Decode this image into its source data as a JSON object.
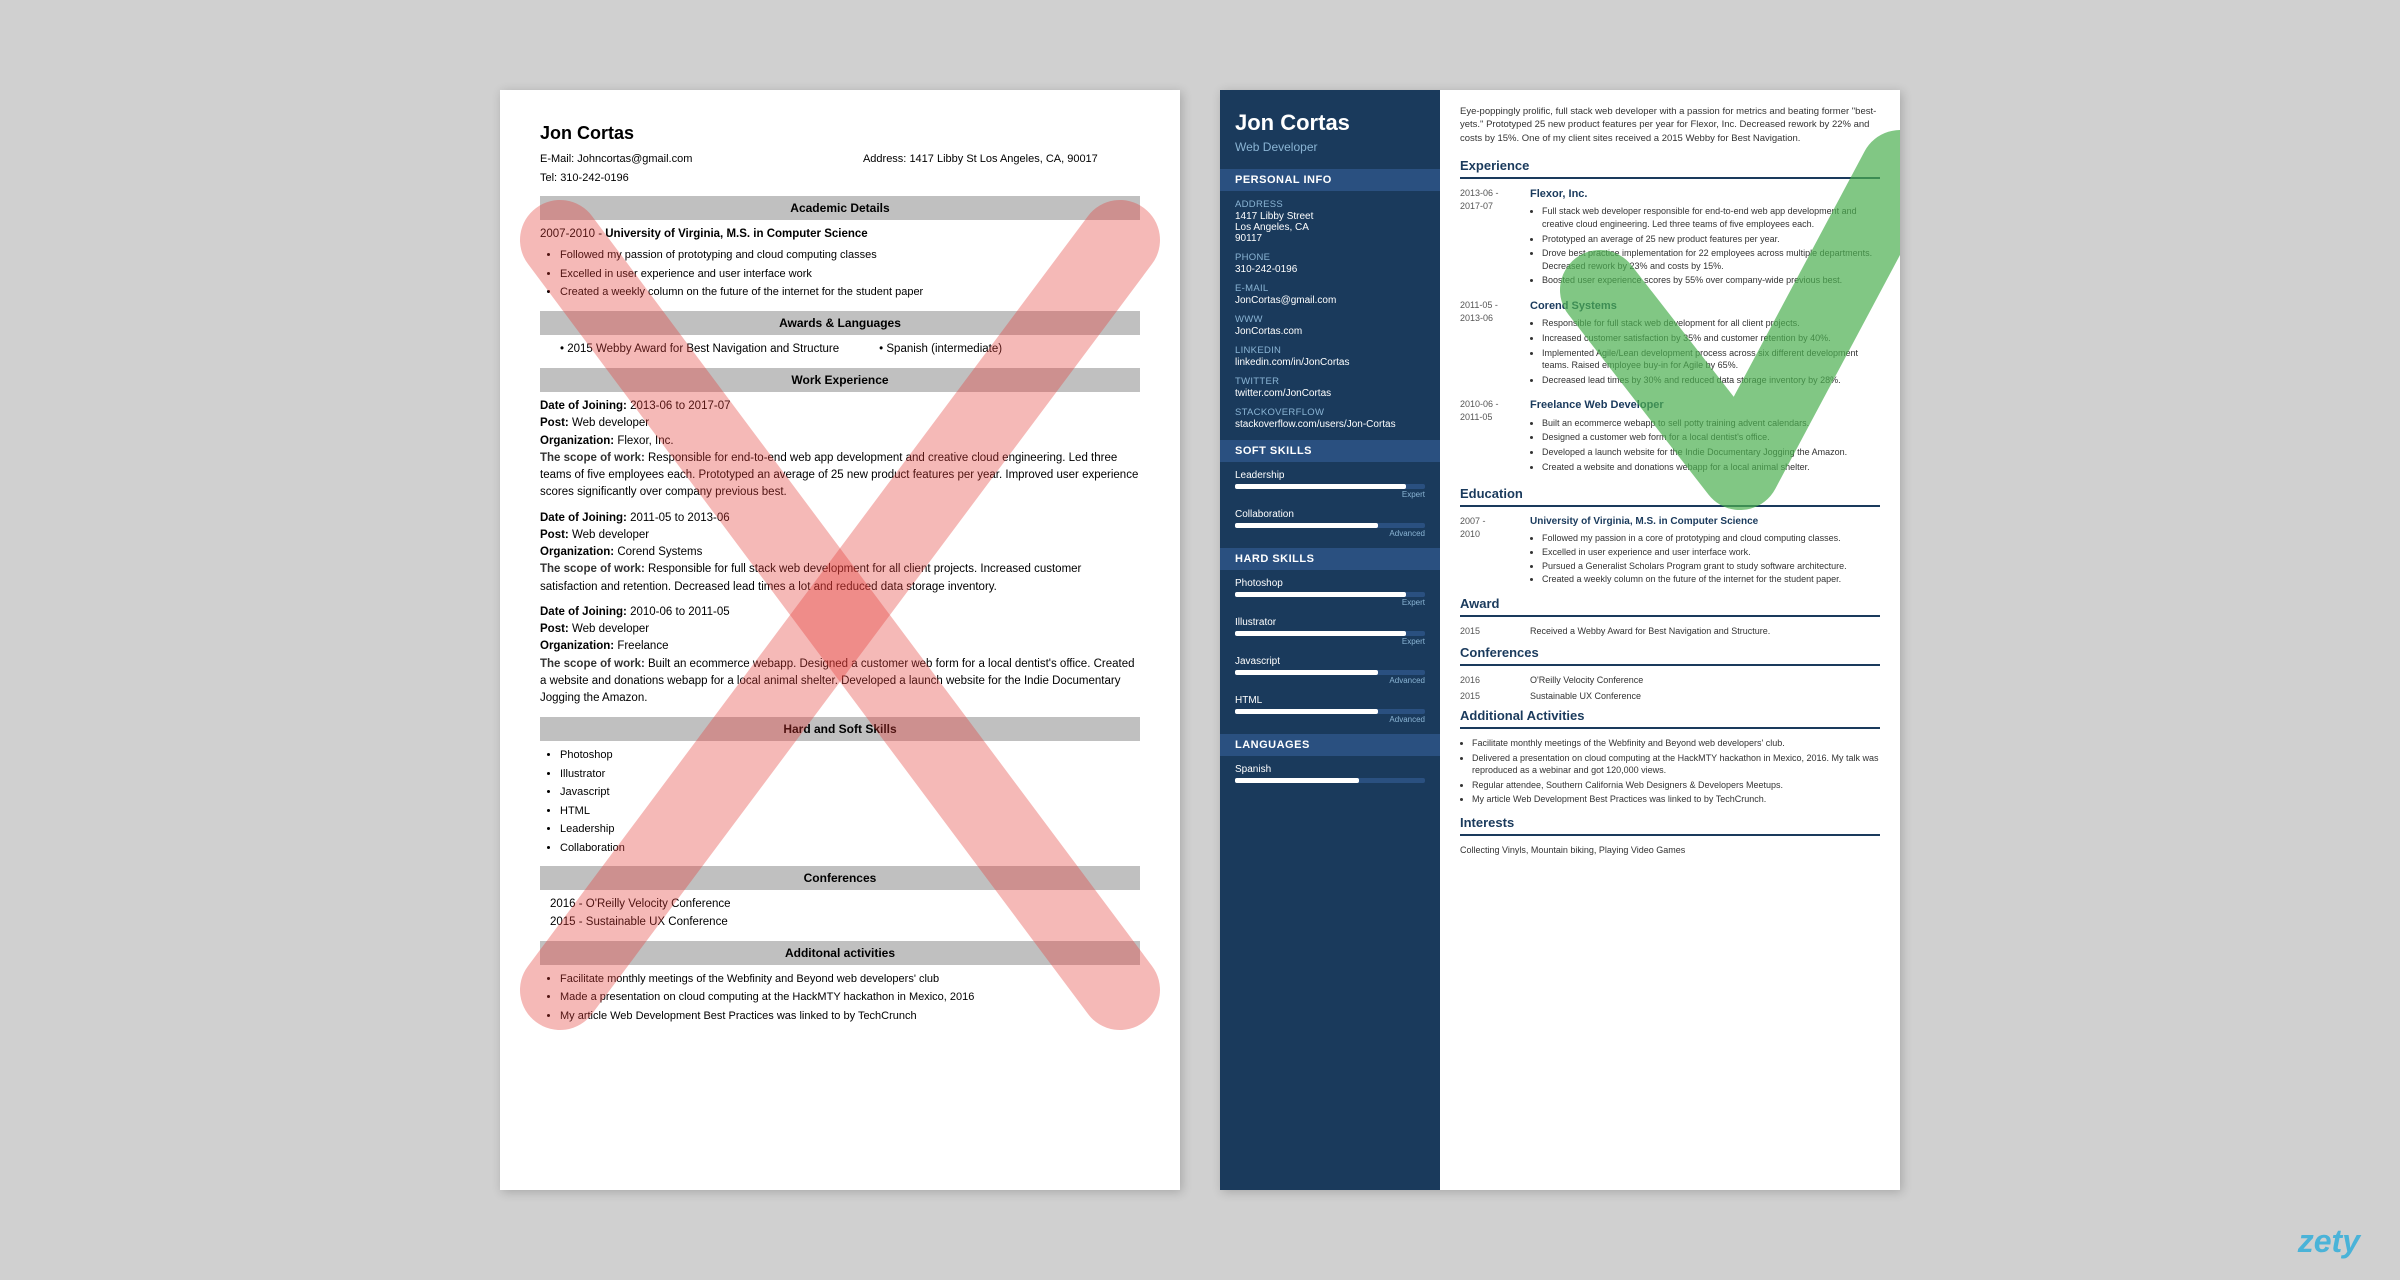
{
  "left_resume": {
    "name": "Jon Cortas",
    "email_label": "E-Mail:",
    "email": "Johncortas@gmail.com",
    "address_label": "Address:",
    "address": "1417 Libby St Los Angeles, CA, 90017",
    "tel_label": "Tel:",
    "tel": "310-242-0196",
    "sections": {
      "academic": {
        "title": "Academic Details",
        "entry": {
          "year": "2007-2010 -",
          "degree": "University of Virginia, M.S. in Computer Science",
          "bullets": [
            "Followed my passion of prototyping and cloud computing classes",
            "Excelled in user experience and user interface work",
            "Created a weekly column on the future of the internet for the student paper"
          ]
        }
      },
      "awards": {
        "title": "Awards & Languages",
        "items": [
          "2015 Webby Award for Best Navigation and Structure",
          "Spanish (intermediate)"
        ]
      },
      "work": {
        "title": "Work Experience",
        "entries": [
          {
            "date_label": "Date of Joining:",
            "date": "2013-06 to 2017-07",
            "post_label": "Post:",
            "post": "Web developer",
            "org_label": "Organization:",
            "org": "Flexor, Inc.",
            "scope_label": "The scope of work:",
            "scope": "Responsible for end-to-end web app development and creative cloud engineering. Led three teams of five employees each. Prototyped an average of 25 new product features per year. Improved user experience scores significantly over company previous best."
          },
          {
            "date_label": "Date of Joining:",
            "date": "2011-05 to 2013-06",
            "post_label": "Post:",
            "post": "Web developer",
            "org_label": "Organization:",
            "org": "Corend Systems",
            "scope_label": "The scope of work:",
            "scope": "Responsible for full stack web development for all client projects. Increased customer satisfaction and retention. Decreased lead times a lot and reduced data storage inventory."
          },
          {
            "date_label": "Date of Joining:",
            "date": "2010-06 to 2011-05",
            "post_label": "Post:",
            "post": "Web developer",
            "org_label": "Organization:",
            "org": "Freelance",
            "scope_label": "The scope of work:",
            "scope": "Built an ecommerce webapp. Designed a customer web form for a local dentist's office. Created a website and donations webapp for a local animal shelter. Developed a launch website for the Indie Documentary Jogging the Amazon."
          }
        ]
      },
      "skills": {
        "title": "Hard and Soft Skills",
        "items": [
          "Photoshop",
          "Illustrator",
          "Javascript",
          "HTML",
          "Leadership",
          "Collaboration"
        ]
      },
      "conferences": {
        "title": "Conferences",
        "items": [
          "2016 - O'Reilly Velocity Conference",
          "2015 - Sustainable UX Conference"
        ]
      },
      "activities": {
        "title": "Additonal activities",
        "bullets": [
          "Facilitate monthly meetings of the Webfinity and Beyond web developers' club",
          "Made a presentation on cloud computing at the HackMTY hackathon in Mexico, 2016",
          "My article Web Development Best Practices was linked to by TechCrunch"
        ]
      }
    }
  },
  "right_resume": {
    "name": "Jon Cortas",
    "title": "Web Developer",
    "bio": "Eye-poppingly prolific, full stack web developer with a passion for metrics and beating former \"best-yets.\" Prototyped 25 new product features per year for Flexor, Inc. Decreased rework by 22% and costs by 15%. One of my client sites received a 2015 Webby for Best Navigation.",
    "sidebar": {
      "personal_info_title": "Personal Info",
      "address_label": "Address",
      "address_value": "1417 Libby Street\nLos Angeles, CA\n90117",
      "phone_label": "Phone",
      "phone_value": "310-242-0196",
      "email_label": "E-mail",
      "email_value": "JonCortas@gmail.com",
      "www_label": "WWW",
      "www_value": "JonCortas.com",
      "linkedin_label": "LinkedIn",
      "linkedin_value": "linkedin.com/in/JonCortas",
      "twitter_label": "Twitter",
      "twitter_value": "twitter.com/JonCortas",
      "stackoverflow_label": "StackOverflow",
      "stackoverflow_value": "stackoverflow.com/users/Jon-Cortas",
      "soft_skills_title": "Soft Skills",
      "soft_skills": [
        {
          "name": "Leadership",
          "level": 90,
          "label": "Expert"
        },
        {
          "name": "Collaboration",
          "level": 75,
          "label": "Advanced"
        }
      ],
      "hard_skills_title": "Hard Skills",
      "hard_skills": [
        {
          "name": "Photoshop",
          "level": 90,
          "label": "Expert"
        },
        {
          "name": "Illustrator",
          "level": 90,
          "label": "Expert"
        },
        {
          "name": "Javascript",
          "level": 75,
          "label": "Advanced"
        },
        {
          "name": "HTML",
          "level": 75,
          "label": "Advanced"
        }
      ],
      "languages_title": "Languages",
      "languages": [
        {
          "name": "Spanish",
          "level": 65,
          "label": ""
        }
      ]
    },
    "experience_title": "Experience",
    "experiences": [
      {
        "date": "2013-06 -\n2017-07",
        "company": "Flexor, Inc.",
        "bullets": [
          "Full stack web developer responsible for end-to-end web app development and creative cloud engineering. Led three teams of five employees each.",
          "Prototyped an average of 25 new product features per year.",
          "Drove best practice implementation for 22 employees across multiple departments. Decreased rework by 23% and costs by 15%.",
          "Boosted user experience scores by 55% over company-wide previous best."
        ]
      },
      {
        "date": "2011-05 -\n2013-06",
        "company": "Corend Systems",
        "bullets": [
          "Responsible for full stack web development for all client projects.",
          "Increased customer satisfaction by 35% and customer retention by 40%.",
          "Implemented Agile/Lean development process across six different development teams. Raised employee buy-in for Agile by 65%.",
          "Decreased lead times by 30% and reduced data storage inventory by 28%."
        ]
      },
      {
        "date": "2010-06 -\n2011-05",
        "company": "Freelance Web Developer",
        "bullets": [
          "Built an ecommerce webapp to sell potty training advent calendars.",
          "Designed a customer web form for a local dentist's office.",
          "Developed a launch website for the Indie Documentary Jogging the Amazon.",
          "Created a website and donations webapp for a local animal shelter."
        ]
      }
    ],
    "education_title": "Education",
    "education": [
      {
        "date": "2007 -\n2010",
        "school": "University of Virginia, M.S. in Computer Science",
        "bullets": [
          "Followed my passion in a core of prototyping and cloud computing classes.",
          "Excelled in user experience and user interface work.",
          "Pursued a Generalist Scholars Program grant to study software architecture.",
          "Created a weekly column on the future of the internet for the student paper."
        ]
      }
    ],
    "award_title": "Award",
    "award": {
      "year": "2015",
      "text": "Received a Webby Award for Best Navigation and Structure."
    },
    "conferences_title": "Conferences",
    "conferences": [
      {
        "year": "2016",
        "name": "O'Reilly Velocity Conference"
      },
      {
        "year": "2015",
        "name": "Sustainable UX Conference"
      }
    ],
    "activities_title": "Additional Activities",
    "activities": [
      "Facilitate monthly meetings of the Webfinity and Beyond web developers' club.",
      "Delivered a presentation on cloud computing at the HackMTY hackathon in Mexico, 2016. My talk was reproduced as a webinar and got 120,000 views.",
      "Regular attendee, Southern California Web Designers & Developers Meetups.",
      "My article Web Development Best Practices was linked to by TechCrunch."
    ],
    "interests_title": "Interests",
    "interests": "Collecting Vinyls, Mountain biking, Playing Video Games"
  },
  "zety_label": "zety"
}
